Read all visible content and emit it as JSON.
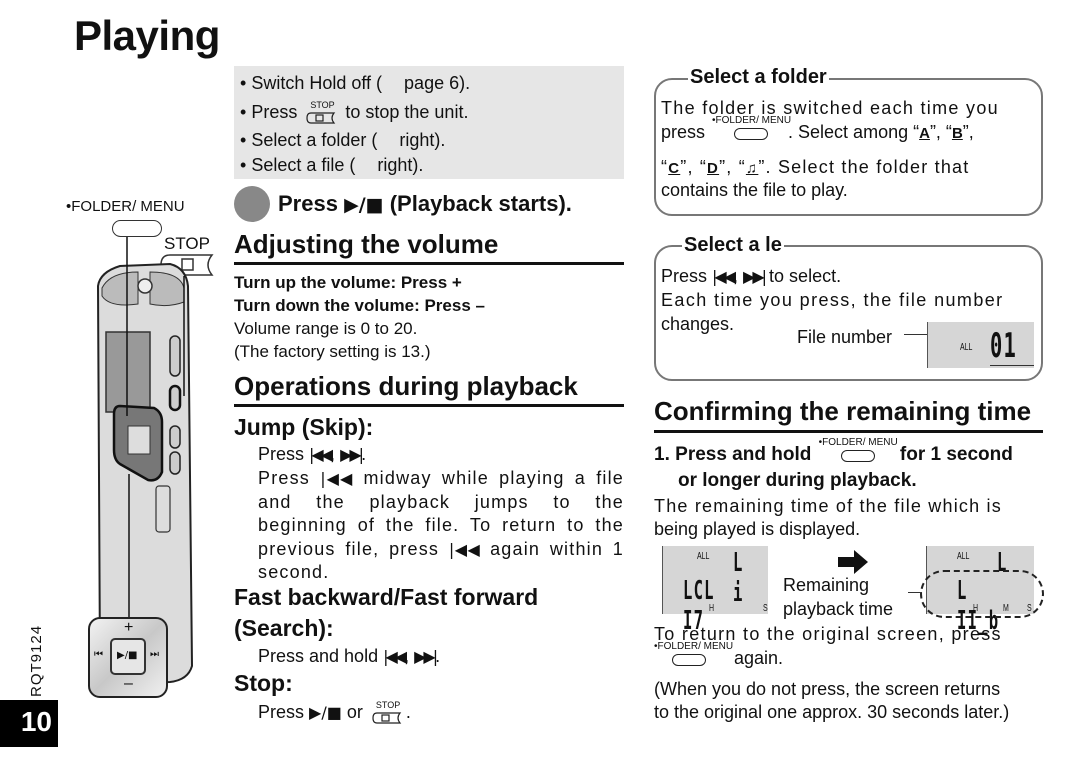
{
  "page": {
    "title": "Playing",
    "page_number": "10",
    "doc_code": "RQT9124"
  },
  "preparation": {
    "items": [
      {
        "pre": "Switch Hold off (",
        "post": "page 6)."
      },
      {
        "pre": "Press",
        "key": "STOP",
        "post": "to stop the unit."
      },
      {
        "pre": "Select a folder (",
        "post": "right)."
      },
      {
        "pre": "Select a file (",
        "post": "right)."
      }
    ],
    "bullet": "•"
  },
  "step1": {
    "press": "Press",
    "play_glyph": "▶/■",
    "rest": "(Playback starts)."
  },
  "keys": {
    "stop": "STOP",
    "folder_menu": "•FOLDER/  MENU",
    "prev": "|◀◀",
    "next": "▶▶|",
    "play_stop": "▶/■"
  },
  "volume": {
    "heading": "Adjusting the volume",
    "up": "Turn up the volume: Press +",
    "down": "Turn down the volume: Press –",
    "range": "Volume range is 0 to 20.",
    "factory": "(The factory setting is 13.)"
  },
  "operations": {
    "heading": "Operations during playback",
    "jump": {
      "heading": "Jump (Skip):",
      "line1_pre": "Press",
      "line1_sep": ",",
      "line1_end": ".",
      "para_pre": "Press",
      "para_mid": "midway while playing a file and the playback jumps to the beginning of the file. To return to the previous file, press",
      "para_end": "again within 1 second."
    },
    "search": {
      "heading1": "Fast backward/Fast forward",
      "heading2": "(Search):",
      "line_pre": "Press and hold",
      "sep": ",",
      "end": "."
    },
    "stop": {
      "heading": "Stop:",
      "line_pre": "Press",
      "or": "or",
      "end": "."
    }
  },
  "select_folder": {
    "title": "Select a folder",
    "line1": "The folder is switched each time you",
    "line2_pre": "press",
    "line2_post": ". Select among “",
    "folders": [
      "A",
      "B",
      "C",
      "D",
      "♫"
    ],
    "line3_post": "”. Select the folder that",
    "line4": "contains the file to play."
  },
  "select_file": {
    "title": "Select a   le",
    "line1_post": "to select.",
    "line2": "Each time you press, the file number",
    "line3": "changes.",
    "callout": "File number",
    "lcd_all": "ALL",
    "lcd_number": "01"
  },
  "remaining": {
    "heading": "Confirming the remaining time",
    "step_num": "1.",
    "step_pre": "Press and hold",
    "step_post": "for 1 second",
    "step_line2": "or longer during playback.",
    "desc1": "The remaining time of the file which is",
    "desc2": "being played is displayed.",
    "lcd_before": {
      "all": "ALL",
      "h": "H",
      "s": "S"
    },
    "lcd_after": {
      "all": "ALL",
      "h": "H",
      "m": "M",
      "s": "S"
    },
    "callout1": "Remaining",
    "callout2": "playback time",
    "return1": "To return to the original screen, press",
    "return2": "again.",
    "note1": "(When you do not press, the screen returns",
    "note2": "to the original one approx. 30 seconds later.)"
  },
  "device": {
    "folder_menu_label": "•FOLDER/  MENU",
    "stop_label": "STOP",
    "pad_plus": "+",
    "pad_minus": "–",
    "pad_prev": "⏮",
    "pad_next": "⏭",
    "pad_center": "▶/■"
  }
}
